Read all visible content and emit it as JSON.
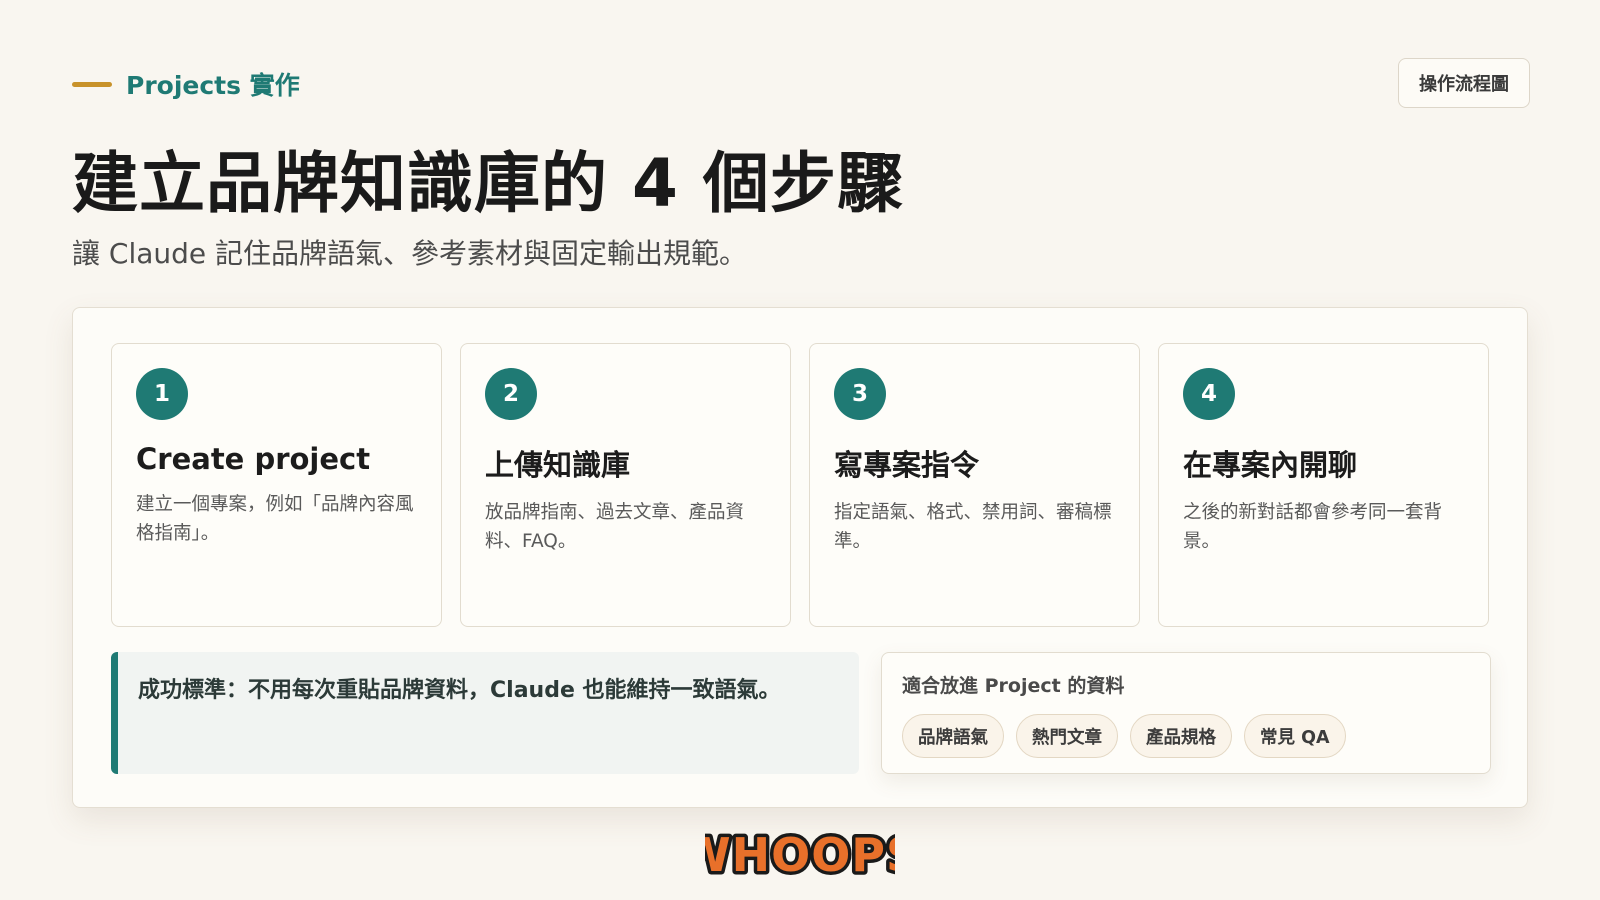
{
  "header": {
    "eyebrow": "Projects 實作",
    "flow_button": "操作流程圖",
    "title": "建立品牌知識庫的 4 個步驟",
    "subtitle": "讓 Claude 記住品牌語氣、參考素材與固定輸出規範。"
  },
  "steps": [
    {
      "number": "1",
      "title": "Create project",
      "desc": "建立一個專案，例如「品牌內容風格指南」。"
    },
    {
      "number": "2",
      "title": "上傳知識庫",
      "desc": "放品牌指南、過去文章、產品資料、FAQ。"
    },
    {
      "number": "3",
      "title": "寫專案指令",
      "desc": "指定語氣、格式、禁用詞、審稿標準。"
    },
    {
      "number": "4",
      "title": "在專案內開聊",
      "desc": "之後的新對話都會參考同一套背景。"
    }
  ],
  "success": {
    "text": "成功標準：不用每次重貼品牌資料，Claude 也能維持一致語氣。"
  },
  "suitable": {
    "title": "適合放進 Project 的資料",
    "tags": [
      "品牌語氣",
      "熱門文章",
      "產品規格",
      "常見 QA"
    ]
  },
  "logo": {
    "text": "WHOOPS",
    "colors": {
      "fill": "#e8702a",
      "outline": "#1a1a1a"
    }
  },
  "colors": {
    "accent": "#1f7a74",
    "eyebrow_line": "#c8922a",
    "background": "#f9f6f0"
  }
}
